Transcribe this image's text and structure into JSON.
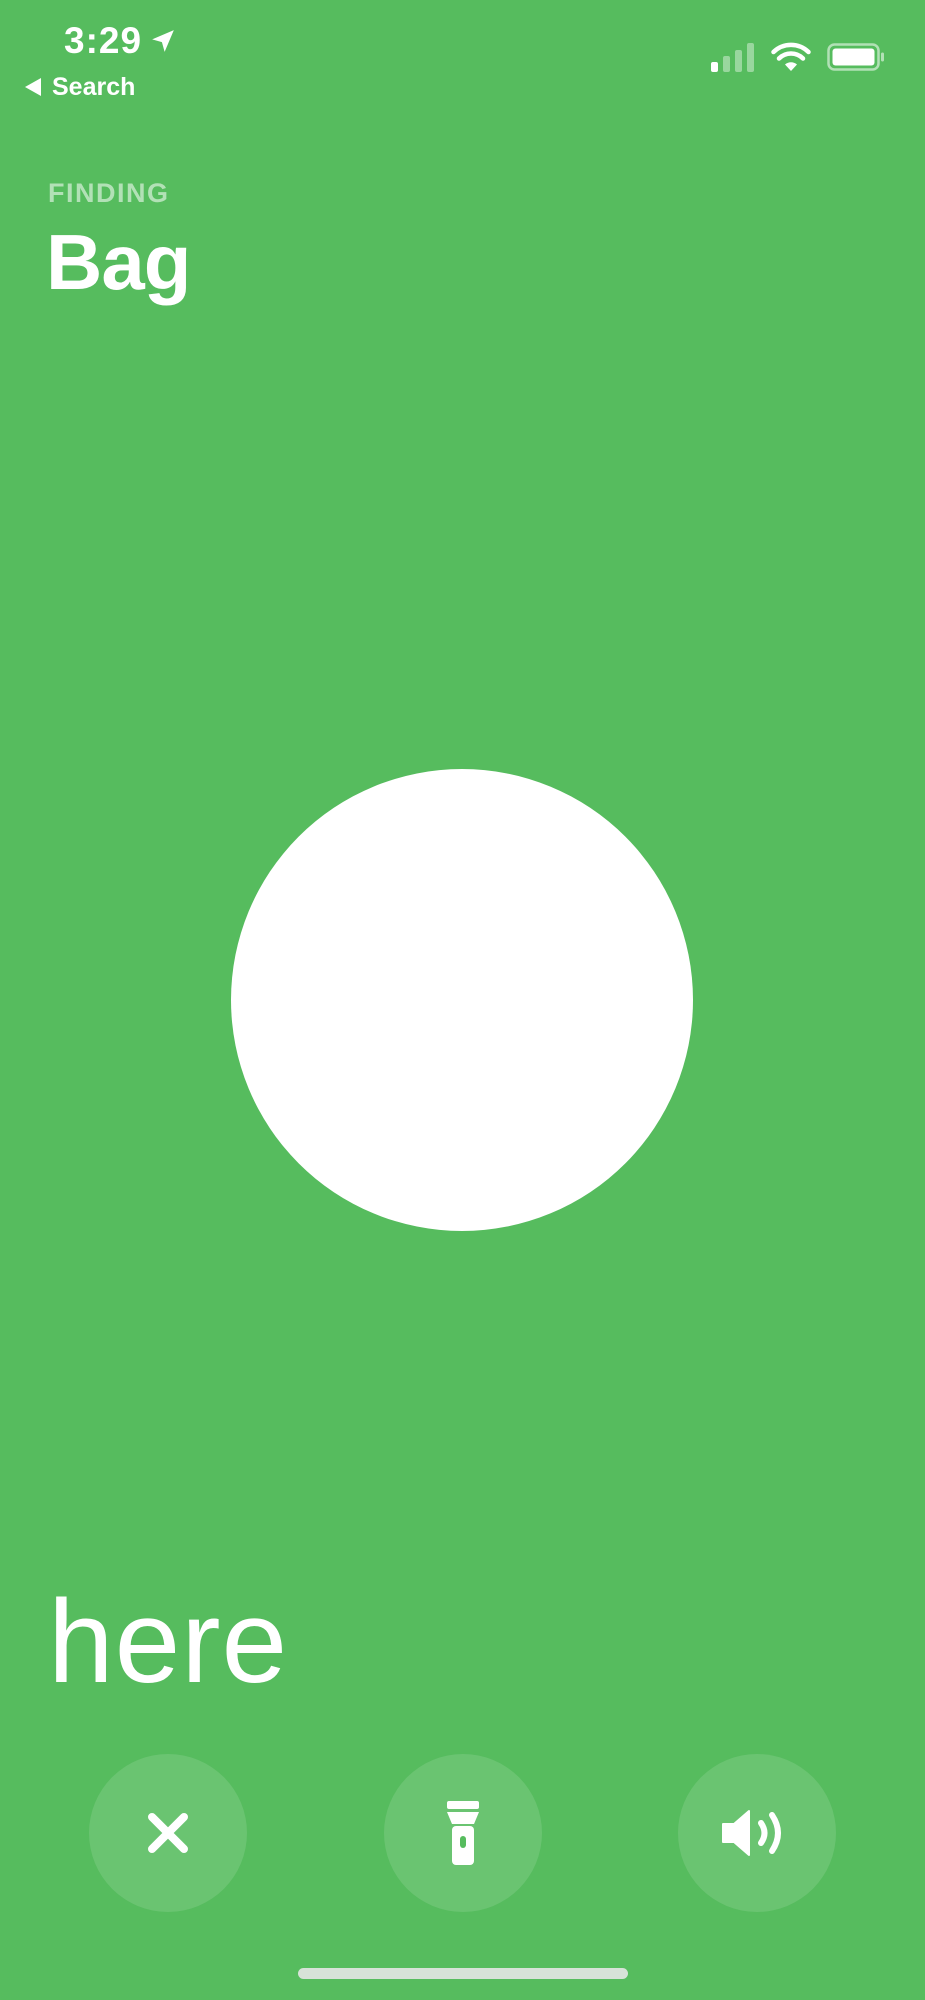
{
  "status_bar": {
    "time": "3:29",
    "location_icon": "location-arrow-icon",
    "signal_icon": "cellular-signal-icon",
    "wifi_icon": "wifi-icon",
    "battery_icon": "battery-icon"
  },
  "nav": {
    "back_label": "Search"
  },
  "header": {
    "eyebrow": "FINDING",
    "title": "Bag"
  },
  "proximity": {
    "status_text": "here"
  },
  "actions": [
    {
      "name": "close",
      "icon": "close-icon"
    },
    {
      "name": "flashlight",
      "icon": "flashlight-icon"
    },
    {
      "name": "play-sound",
      "icon": "speaker-icon"
    }
  ],
  "colors": {
    "background": "#56bc5e",
    "foreground": "#ffffff"
  }
}
